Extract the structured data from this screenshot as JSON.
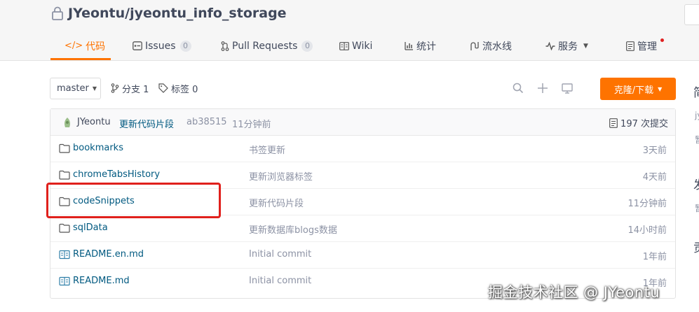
{
  "repo": {
    "title": "JYeontu/jyeontu_info_storage"
  },
  "tabs": [
    {
      "label": "代码",
      "icon": "code-icon",
      "active": true
    },
    {
      "label": "Issues",
      "icon": "issues-icon",
      "count": "0"
    },
    {
      "label": "Pull Requests",
      "icon": "pull-request-icon",
      "count": "0"
    },
    {
      "label": "Wiki",
      "icon": "wiki-icon"
    },
    {
      "label": "统计",
      "icon": "stats-icon"
    },
    {
      "label": "流水线",
      "icon": "pipeline-icon"
    },
    {
      "label": "服务",
      "icon": "service-icon"
    },
    {
      "label": "管理",
      "icon": "manage-icon"
    }
  ],
  "toolbar": {
    "branch": "master",
    "branches_label": "分支 1",
    "tags_label": "标签 0",
    "clone_label": "克隆/下载"
  },
  "commit": {
    "author": "JYeontu",
    "message": "更新代码片段",
    "sha": "ab38515",
    "time": "11分钟前",
    "count_label": "197 次提交"
  },
  "files": [
    {
      "type": "folder",
      "name": "bookmarks",
      "message": "书签更新",
      "time": "3天前"
    },
    {
      "type": "folder",
      "name": "chromeTabsHistory",
      "message": "更新浏览器标签",
      "time": "4天前"
    },
    {
      "type": "folder",
      "name": "codeSnippets",
      "message": "更新代码片段",
      "time": "11分钟前"
    },
    {
      "type": "folder",
      "name": "sqlData",
      "message": "更新数据库blogs数据",
      "time": "14小时前"
    },
    {
      "type": "file",
      "name": "README.en.md",
      "message": "Initial commit",
      "time": "1年前"
    },
    {
      "type": "file",
      "name": "README.md",
      "message": "Initial commit",
      "time": "1年前"
    }
  ],
  "sidebar_partial": [
    "简",
    "jy",
    "暂",
    "发",
    "暂",
    "贡"
  ],
  "watermark": "掘金技术社区 @ JYeontu",
  "colors": {
    "accent": "#fe7300",
    "link": "#005980",
    "highlight": "#e0201c"
  }
}
